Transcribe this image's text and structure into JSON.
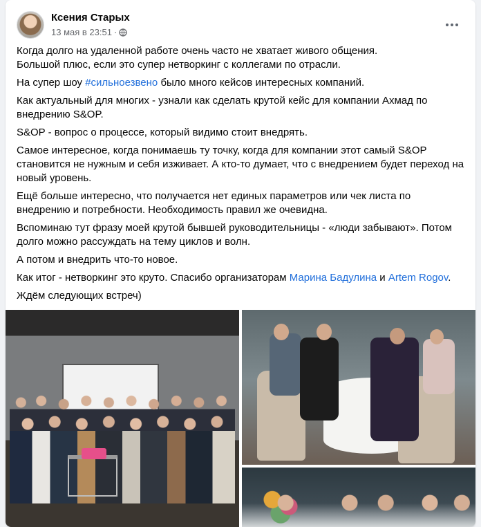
{
  "post": {
    "author": "Ксения Старых",
    "timestamp": "13 мая в 23:51",
    "separator": "·",
    "privacy_icon": "globe-icon",
    "more_icon": "more-horizontal-icon"
  },
  "body": {
    "p1_line1": "Когда долго на удаленной работе очень часто не хватает живого общения.",
    "p1_line2": "Большой плюс, если это супер нетворкинг с коллегами по отрасли.",
    "p2_before": "На супер шоу ",
    "p2_hashtag": "#сильноезвено",
    "p2_after": " было много кейсов интересных компаний.",
    "p3": "Как актуальный для многих - узнали как сделать крутой кейс для компании Ахмад по внедрению S&OP.",
    "p4": "S&OP - вопрос о процессе, который видимо стоит внедрять.",
    "p5": "Самое интересное, когда понимаешь ту точку, когда для компании этот самый S&OP становится не нужным и себя изживает. А кто-то думает, что с внедрением будет переход на новый уровень.",
    "p6": "Ещё больше интересно, что получается нет единых параметров или чек листа по внедрению и потребности. Необходимость правил же очевидна.",
    "p7": "Вспоминаю тут фразу моей крутой бывшей руководительницы - «люди забывают». Потом долго можно рассуждать на тему циклов и волн.",
    "p8": "А потом и внедрить что-то новое.",
    "p9_before": "Как итог - нетворкинг это круто. Спасибо организаторам ",
    "p9_link1": "Марина Бадулина",
    "p9_mid": " и ",
    "p9_link2": "Artem Rogov",
    "p9_after": ".",
    "p10": "Ждём следующих встреч)"
  },
  "colors": {
    "link": "#216fdb",
    "text": "#050505",
    "meta": "#65676b"
  }
}
